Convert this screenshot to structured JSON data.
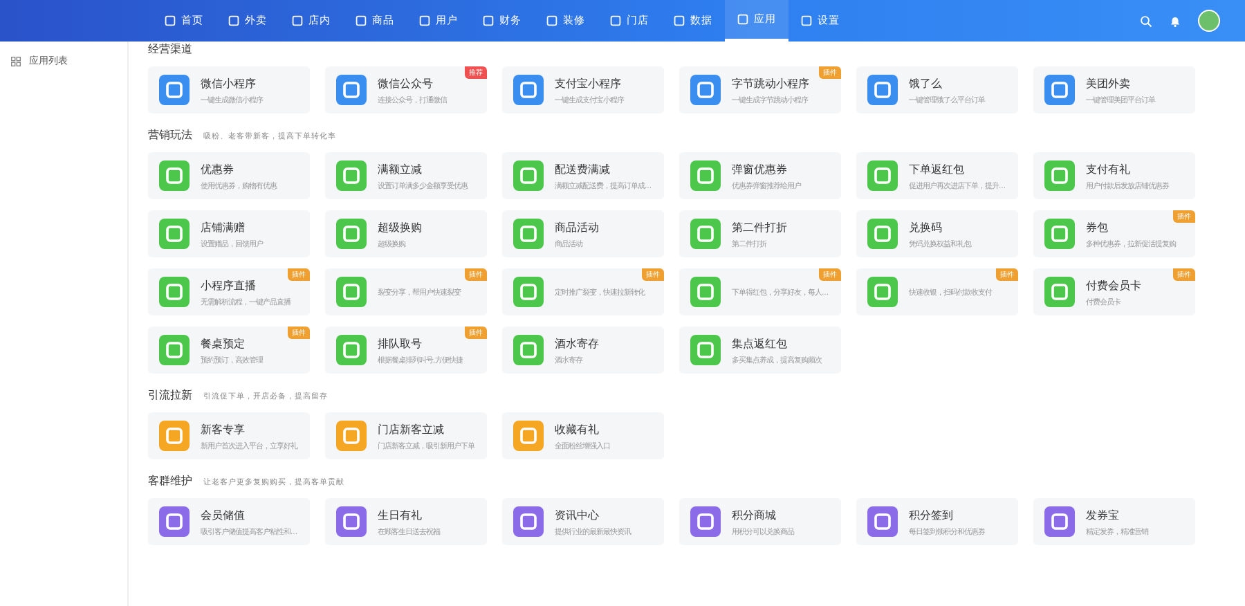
{
  "nav": {
    "items": [
      {
        "label": "首页",
        "selected": false
      },
      {
        "label": "外卖",
        "selected": false
      },
      {
        "label": "店内",
        "selected": false
      },
      {
        "label": "商品",
        "selected": false
      },
      {
        "label": "用户",
        "selected": false
      },
      {
        "label": "财务",
        "selected": false
      },
      {
        "label": "装修",
        "selected": false
      },
      {
        "label": "门店",
        "selected": false
      },
      {
        "label": "数据",
        "selected": false
      },
      {
        "label": "应用",
        "selected": true
      },
      {
        "label": "设置",
        "selected": false
      }
    ]
  },
  "sidebar": {
    "items": [
      {
        "label": "应用列表"
      }
    ]
  },
  "sections": [
    {
      "title": "经营渠道",
      "color": "#3a8ef0",
      "cards": [
        {
          "title": "微信小程序",
          "desc": "一键生成微信小程序"
        },
        {
          "title": "微信公众号",
          "desc": "连接公众号，打通微信",
          "badge": "推荐",
          "color": "#f05050"
        },
        {
          "title": "支付宝小程序",
          "desc": "一键生成支付宝小程序"
        },
        {
          "title": "字节跳动小程序",
          "desc": "一键生成字节跳动小程序",
          "badge": "插件",
          "color": "#f0a030"
        },
        {
          "title": "饿了么",
          "desc": "一键管理饿了么平台订单"
        },
        {
          "title": "美团外卖",
          "desc": "一键管理美团平台订单"
        }
      ]
    },
    {
      "title": "营销玩法",
      "subtitle": "吸粉、老客带新客，提高下单转化率",
      "color": "#4cc74c",
      "cards": [
        {
          "title": "优惠券",
          "desc": "使用优惠券，购物有优惠"
        },
        {
          "title": "满额立减",
          "desc": "设置订单满多少金额享受优惠"
        },
        {
          "title": "配送费满减",
          "desc": "满额立减配送费，提高订单成..."
        },
        {
          "title": "弹窗优惠券",
          "desc": "优惠券弹窗推荐给用户"
        },
        {
          "title": "下单返红包",
          "desc": "促进用户再次进店下单，提升..."
        },
        {
          "title": "支付有礼",
          "desc": "用户付款后发放店铺优惠券"
        },
        {
          "title": "店铺满赠",
          "desc": "设置赠品，回馈用户"
        },
        {
          "title": "超级换购",
          "desc": "超级换购"
        },
        {
          "title": "商品活动",
          "desc": "商品活动"
        },
        {
          "title": "第二件打折",
          "desc": "第二件打折"
        },
        {
          "title": "兑换码",
          "desc": "凭码兑换权益和礼包"
        },
        {
          "title": "券包",
          "desc": "多种优惠券，拉新促活提复购",
          "badge": "插件",
          "color": "#f0a030"
        },
        {
          "title": "小程序直播",
          "desc": "无需解析流程，一键产品直播",
          "badge": "插件",
          "color": "#f0a030"
        },
        {
          "desc": "裂变分享，帮用户快速裂变",
          "badge": "插件",
          "color": "#f0a030"
        },
        {
          "desc": "定时推广裂变，快速拉新转化",
          "badge": "插件",
          "color": "#f0a030"
        },
        {
          "desc": "下单得红包，分享好友，每人...",
          "badge": "插件",
          "color": "#f0a030"
        },
        {
          "desc": "快速收银，扫码付款收支付",
          "badge": "插件",
          "color": "#f0a030"
        },
        {
          "title": "付费会员卡",
          "desc": "付费会员卡",
          "badge": "插件",
          "color": "#f0a030"
        },
        {
          "title": "餐桌预定",
          "desc": "预約预订，高效管理",
          "badge": "插件",
          "color": "#f0a030"
        },
        {
          "title": "排队取号",
          "desc": "根据餐桌排列叫号,方便快捷",
          "badge": "插件",
          "color": "#f0a030"
        },
        {
          "title": "酒水寄存",
          "desc": "酒水寄存"
        },
        {
          "title": "集点返红包",
          "desc": "多买集点养成，提高复购频次"
        }
      ]
    },
    {
      "title": "引流拉新",
      "subtitle": "引流促下单，开店必备，提高留存",
      "color": "#f5a623",
      "cards": [
        {
          "title": "新客专享",
          "desc": "新用户首次进入平台，立享好礼"
        },
        {
          "title": "门店新客立减",
          "desc": "门店新客立减，吸引新用户下单"
        },
        {
          "title": "收藏有礼",
          "desc": "全面粉丝增强入口"
        }
      ]
    },
    {
      "title": "客群维护",
      "subtitle": "让老客户更多复购购买，提高客单贡献",
      "color": "#8b6be8",
      "cards": [
        {
          "title": "会员储值",
          "desc": "吸引客户储值提高客户粘性和..."
        },
        {
          "title": "生日有礼",
          "desc": "在顾客生日送去祝福"
        },
        {
          "title": "资讯中心",
          "desc": "提供行业的最新最快资讯"
        },
        {
          "title": "积分商城",
          "desc": "用积分可以兑换商品"
        },
        {
          "title": "积分签到",
          "desc": "每日签到领积分和优惠券"
        },
        {
          "title": "发券宝",
          "desc": "精定发券，精准营销"
        }
      ]
    }
  ]
}
